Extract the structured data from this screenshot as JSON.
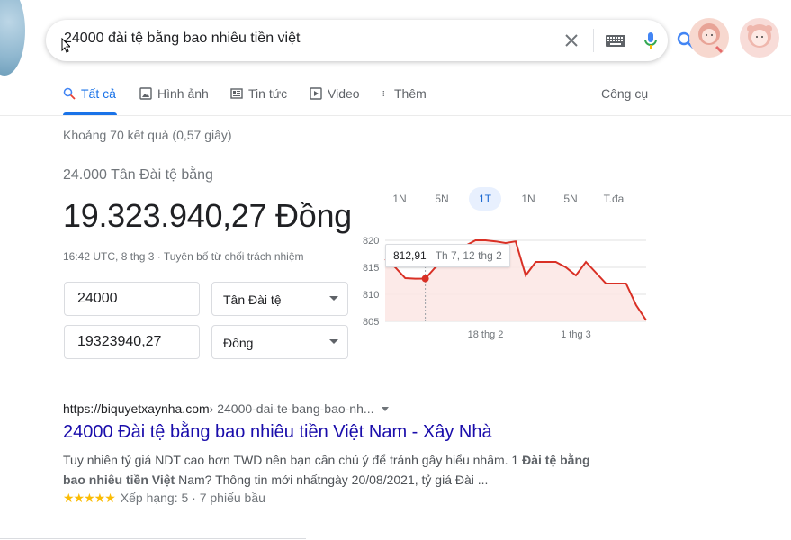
{
  "search": {
    "query": "24000 đài tệ bằng bao nhiêu tiền việt"
  },
  "tabs": {
    "all": "Tất cả",
    "images": "Hình ảnh",
    "news": "Tin tức",
    "videos": "Video",
    "more": "Thêm",
    "tools": "Công cụ"
  },
  "result_stats": "Khoảng 70 kết quả (0,57 giây)",
  "converter": {
    "label": "24.000 Tân Đài tệ bằng",
    "value": "19.323.940,27 Đồng",
    "time": "16:42 UTC, 8 thg 3 · Tuyên bố từ chối trách nhiệm",
    "from_amount": "24000",
    "from_currency": "Tân Đài tệ",
    "to_amount": "19323940,27",
    "to_currency": "Đồng"
  },
  "range_tabs": [
    "1N",
    "5N",
    "1T",
    "1N",
    "5N",
    "T.đa"
  ],
  "range_active_index": 2,
  "chart_data": {
    "type": "area",
    "x_ticks": [
      "18 thg 2",
      "1 thg 3"
    ],
    "y_ticks": [
      820,
      815,
      810,
      805
    ],
    "ylim": [
      805,
      820
    ],
    "values": [
      816.5,
      815,
      813,
      812.9,
      812.91,
      815,
      816,
      818,
      819,
      820,
      820,
      819.8,
      819.5,
      819.8,
      813.5,
      816,
      816,
      816,
      815,
      813.5,
      816,
      814,
      812,
      812,
      812,
      808,
      805.2
    ],
    "highlight_index": 4,
    "tooltip": {
      "value": "812,91",
      "date": "Th 7, 12 thg 2"
    },
    "line_color": "#d93025",
    "fill_color": "#fce8e6"
  },
  "result": {
    "domain": "https://biquyetxaynha.com",
    "path": " › 24000-dai-te-bang-bao-nh...",
    "title": "24000 Đài tệ bằng bao nhiêu tiền Việt Nam - Xây Nhà",
    "snippet_1": "Tuy nhiên tỷ giá NDT cao hơn TWD nên bạn cần chú ý để tránh gây hiểu nhầm. 1 ",
    "snippet_bold_1": "Đài tệ bằng bao nhiêu tiền Việt",
    "snippet_2": " Nam? Thông tin mới nhấtngày 20/08/2021, tỷ giá Đài ...",
    "stars": "★★★★★",
    "rating": "Xếp hạng: 5 · 7 phiếu bầu"
  },
  "colors": {
    "accent": "#1a73e8",
    "link": "#1a0dab",
    "chart_line": "#d93025",
    "stars": "#fbbc04"
  }
}
